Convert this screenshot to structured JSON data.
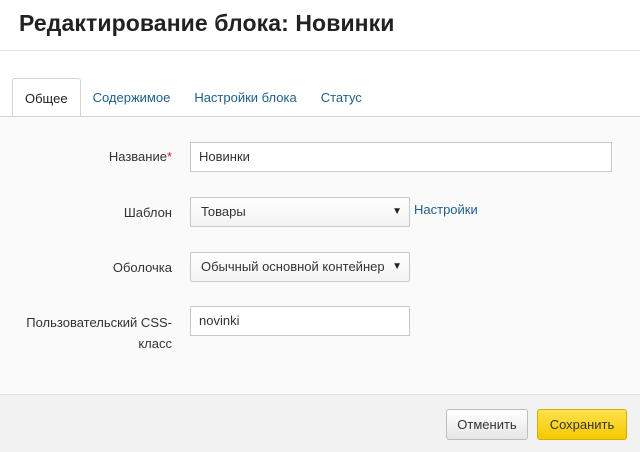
{
  "header": {
    "title": "Редактирование блока: Новинки"
  },
  "tabs": [
    {
      "label": "Общее",
      "active": true
    },
    {
      "label": "Содержимое",
      "active": false
    },
    {
      "label": "Настройки блока",
      "active": false
    },
    {
      "label": "Статус",
      "active": false
    }
  ],
  "form": {
    "name": {
      "label": "Название",
      "required_mark": "*",
      "value": "Новинки"
    },
    "template": {
      "label": "Шаблон",
      "selected": "Товары",
      "settings_link": "Настройки"
    },
    "wrapper": {
      "label": "Оболочка",
      "selected": "Обычный основной контейнер"
    },
    "css_class": {
      "label_line1": "Пользовательский CSS-",
      "label_line2": "класс",
      "value": "novinki"
    }
  },
  "footer": {
    "cancel_label": "Отменить",
    "save_label": "Сохранить"
  },
  "colors": {
    "accent": "#f5c800",
    "link": "#1f5e89",
    "required": "#d31e1e"
  }
}
